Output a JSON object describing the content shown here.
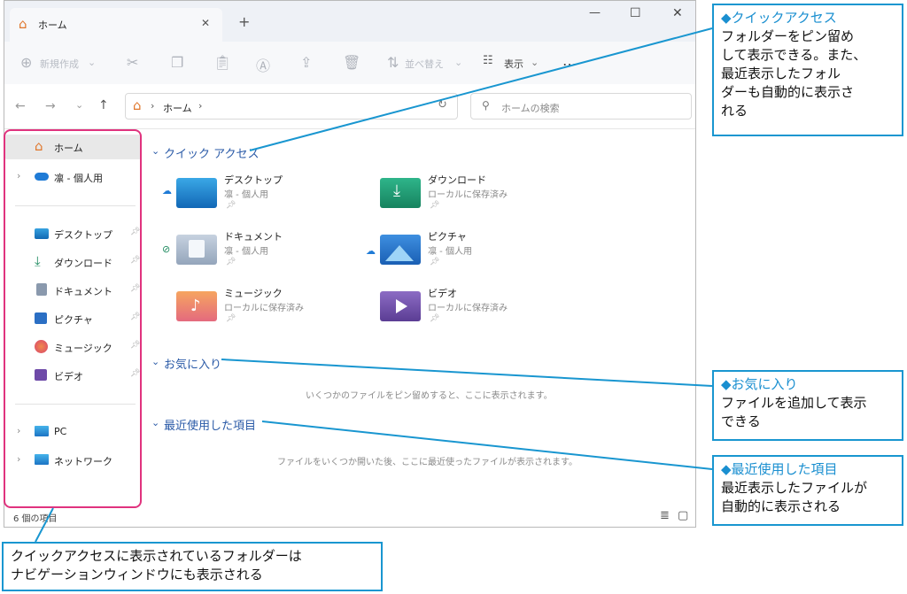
{
  "window": {
    "tab_title": "ホーム",
    "tab_close": "✕",
    "new_tab": "+",
    "controls": {
      "minimize": "—",
      "maximize": "☐",
      "close": "✕"
    }
  },
  "toolbar": {
    "new_label": "新規作成",
    "sort_label": "並べ替え",
    "view_label": "表示",
    "more": "…"
  },
  "address": {
    "home": "ホーム",
    "sep1": "›",
    "sep2": "›",
    "search_placeholder": "ホームの検索"
  },
  "sidebar": {
    "home": "ホーム",
    "onedrive": "凛 - 個人用",
    "pinned": [
      "デスクトップ",
      "ダウンロード",
      "ドキュメント",
      "ピクチャ",
      "ミュージック",
      "ビデオ"
    ],
    "pc": "PC",
    "network": "ネットワーク"
  },
  "sections": {
    "quick_access": "クイック アクセス",
    "favorites": "お気に入り",
    "recent": "最近使用した項目",
    "favorites_empty": "いくつかのファイルをピン留めすると、ここに表示されます。",
    "recent_empty": "ファイルをいくつか開いた後、ここに最近使ったファイルが表示されます。"
  },
  "folders": [
    {
      "name": "デスクトップ",
      "sub": "凛 - 個人用"
    },
    {
      "name": "ダウンロード",
      "sub": "ローカルに保存済み"
    },
    {
      "name": "ドキュメント",
      "sub": "凛 - 個人用"
    },
    {
      "name": "ピクチャ",
      "sub": "凛 - 個人用"
    },
    {
      "name": "ミュージック",
      "sub": "ローカルに保存済み"
    },
    {
      "name": "ビデオ",
      "sub": "ローカルに保存済み"
    }
  ],
  "status": {
    "count": "6 個の項目"
  },
  "callouts": {
    "quick": {
      "title": "◆クイックアクセス",
      "body": [
        "フォルダーをピン留め",
        "して表示できる。また、",
        "最近表示したフォル",
        "ダーも自動的に表示さ",
        "れる"
      ]
    },
    "fav": {
      "title": "◆お気に入り",
      "body": [
        "ファイルを追加して表示",
        "できる"
      ]
    },
    "recent": {
      "title": "◆最近使用した項目",
      "body": [
        "最近表示したファイルが",
        "自動的に表示される"
      ]
    },
    "nav": {
      "body": [
        "クイックアクセスに表示されているフォルダーは",
        "ナビゲーションウィンドウにも表示される"
      ]
    }
  },
  "colors": {
    "accent_blue": "#1996d0",
    "highlight_pink": "#e0337e",
    "section_blue": "#2a5aa7"
  }
}
